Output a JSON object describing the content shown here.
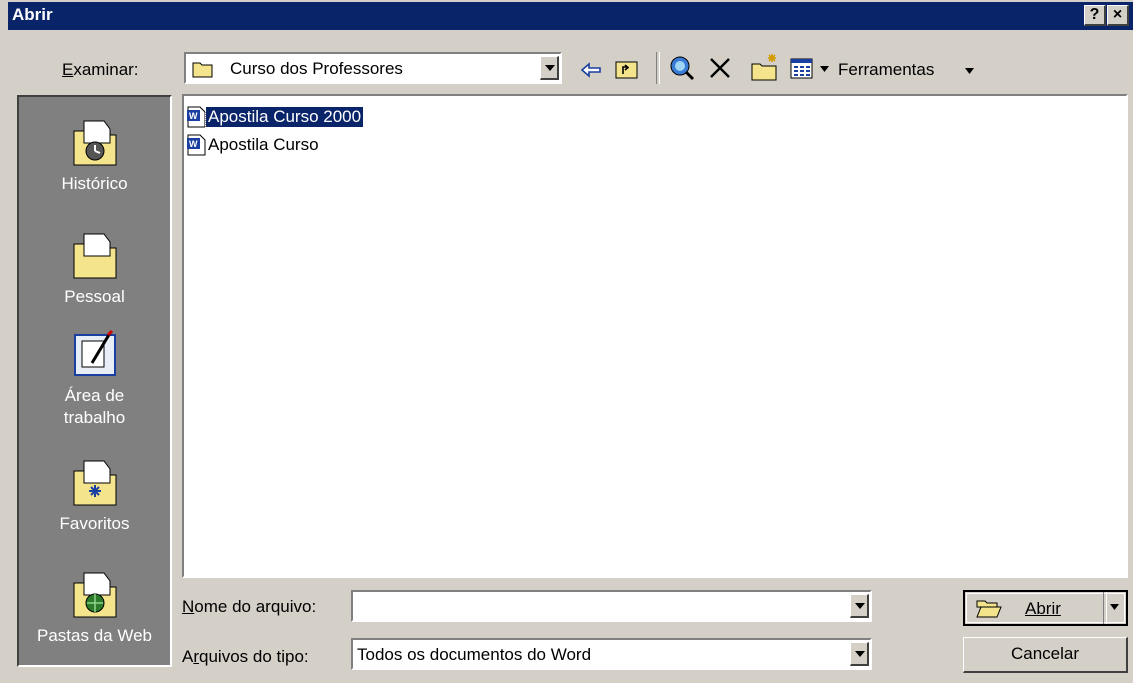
{
  "window": {
    "title": "Abrir",
    "help_button": "?",
    "close_button": "×"
  },
  "toolbar": {
    "look_in_label": "Examinar:",
    "look_in_value": "Curso dos Professores",
    "tools_label": "Ferramentas"
  },
  "places": [
    {
      "label": "Histórico",
      "icon": "history-folder-icon"
    },
    {
      "label": "Pessoal",
      "icon": "personal-folder-icon"
    },
    {
      "label": "Área de trabalho",
      "icon": "desktop-icon"
    },
    {
      "label": "Favoritos",
      "icon": "favorites-folder-icon"
    },
    {
      "label": "Pastas da Web",
      "icon": "web-folders-icon"
    }
  ],
  "files": [
    {
      "name": "Apostila Curso 2000",
      "icon": "word-document-icon",
      "selected": true
    },
    {
      "name": "Apostila Curso",
      "icon": "word-document-icon",
      "selected": false
    }
  ],
  "filename": {
    "label": "Nome do arquivo:",
    "value": ""
  },
  "filetype": {
    "label": "Arquivos do tipo:",
    "value": "Todos os documentos do Word"
  },
  "buttons": {
    "open": "Abrir",
    "cancel": "Cancelar"
  },
  "colors": {
    "titlebar": "#0a246a",
    "dialog": "#d4d0c8",
    "places_bar": "#808080",
    "selection": "#0a246a"
  }
}
